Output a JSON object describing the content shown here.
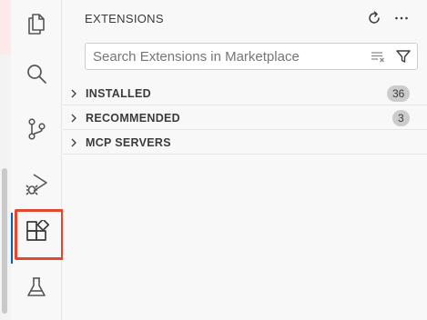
{
  "sidebar": {
    "title": "EXTENSIONS",
    "search": {
      "placeholder": "Search Extensions in Marketplace",
      "value": ""
    },
    "header_actions": [
      "refresh-icon",
      "more-actions-icon"
    ],
    "search_actions": [
      "clear-filter-icon",
      "filter-icon"
    ],
    "sections": [
      {
        "label": "INSTALLED",
        "count": "36"
      },
      {
        "label": "RECOMMENDED",
        "count": "3"
      },
      {
        "label": "MCP SERVERS",
        "count": ""
      }
    ]
  },
  "activity_bar": {
    "items": [
      "explorer-icon",
      "search-icon",
      "source-control-icon",
      "run-debug-icon",
      "extensions-icon",
      "testing-icon"
    ],
    "active": "extensions-icon"
  },
  "colors": {
    "highlight_border": "#e2472f",
    "active_indicator": "#005fb8",
    "badge_bg": "#cccccc"
  }
}
